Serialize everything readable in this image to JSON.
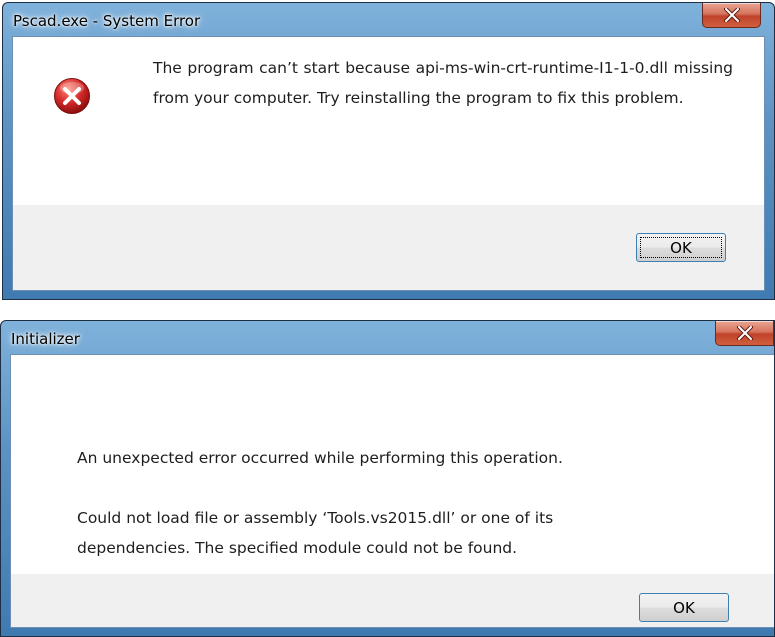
{
  "dialogs": [
    {
      "title": "Pscad.exe - System Error",
      "icon": "error-icon",
      "message": "The program can’t start because api-ms-win-crt-runtime-I1-1-0.dll missing from your computer. Try reinstalling the program to fix this problem.",
      "ok_label": "OK"
    },
    {
      "title": "Initializer",
      "message_line1": "An unexpected error occurred while performing this operation.",
      "message_line2": "Could not load file or assembly ‘Tools.vs2015.dll’ or one of its dependencies. The specified module could not be found.",
      "ok_label": "OK"
    }
  ],
  "colors": {
    "title_bar": "#5d93c3",
    "close_button": "#c0422a",
    "error_icon": "#d42a2a",
    "button_border": "#3c7fb1"
  }
}
